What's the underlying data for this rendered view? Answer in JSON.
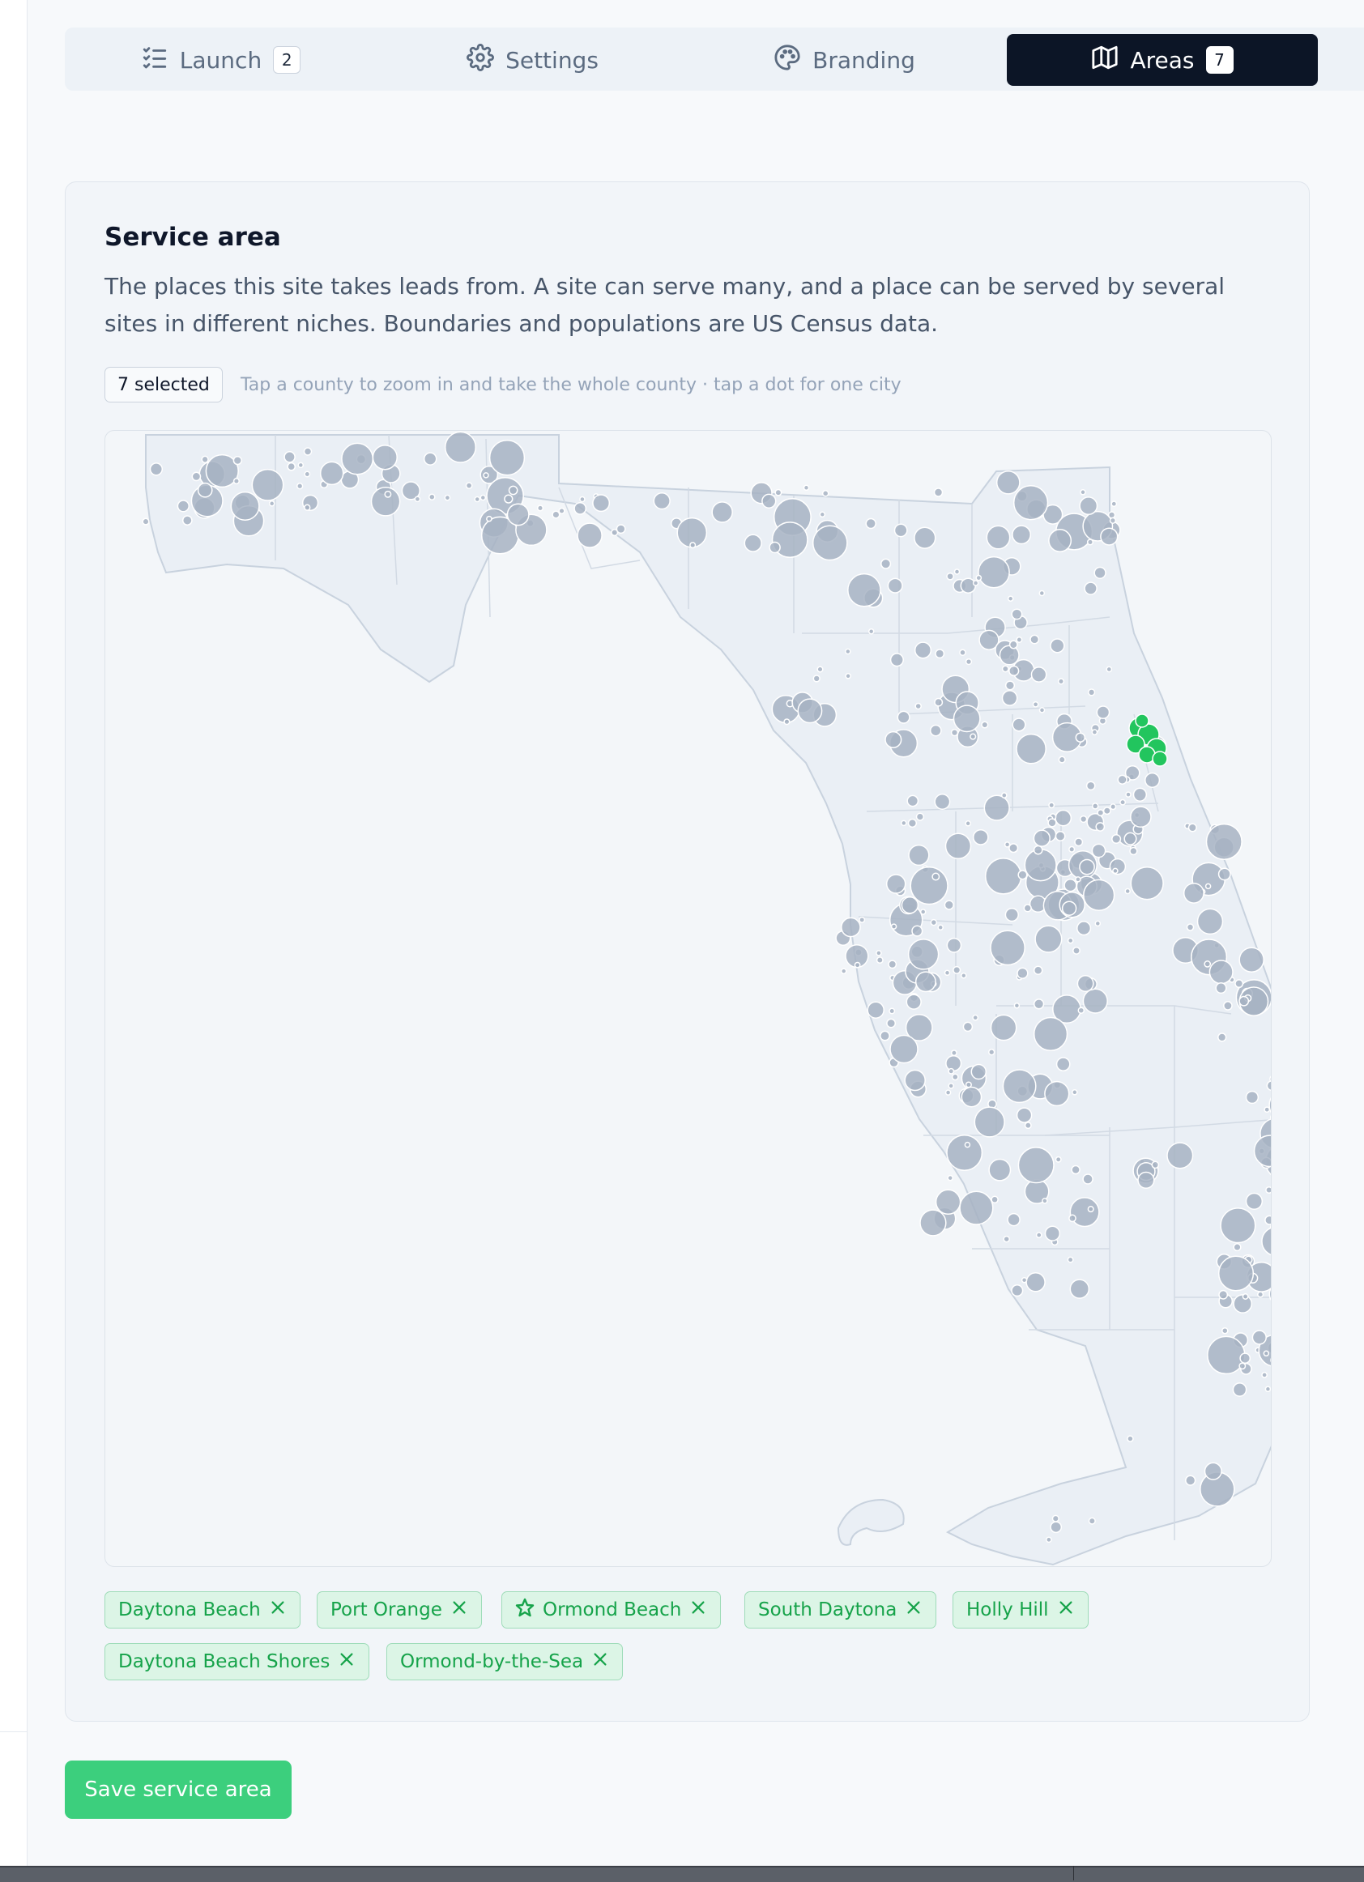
{
  "tabs": [
    {
      "label": "Launch",
      "count": "2",
      "icon": "checklist-icon",
      "active": false
    },
    {
      "label": "Settings",
      "icon": "gear-icon",
      "active": false
    },
    {
      "label": "Branding",
      "icon": "palette-icon",
      "active": false
    },
    {
      "label": "Areas",
      "count": "7",
      "icon": "map-icon",
      "active": true
    }
  ],
  "service_area": {
    "title": "Service area",
    "description": "The places this site takes leads from. A site can serve many, and a place can be served by several sites in different niches. Boundaries and populations are US Census data.",
    "selected_badge": "7 selected",
    "hint": "Tap a county to zoom in and take the whole county · tap a dot for one city"
  },
  "map": {
    "region": "Florida",
    "dot_color": "#a7b3c3",
    "selected_dot_color": "#22c55e",
    "selected_places": [
      "Daytona Beach",
      "Port Orange",
      "Ormond Beach",
      "South Daytona",
      "Holly Hill",
      "Daytona Beach Shores",
      "Ormond-by-the-Sea"
    ]
  },
  "chips": [
    {
      "label": "Daytona Beach",
      "starred": false
    },
    {
      "label": "Port Orange",
      "starred": false
    },
    {
      "label": "Ormond Beach",
      "starred": true
    },
    {
      "label": "South Daytona",
      "starred": false
    },
    {
      "label": "Holly Hill",
      "starred": false
    },
    {
      "label": "Daytona Beach Shores",
      "starred": false
    },
    {
      "label": "Ormond-by-the-Sea",
      "starred": false
    }
  ],
  "save_button": "Save service area",
  "colors": {
    "accent": "#3ccf7d",
    "tab_active_bg": "#0c1526",
    "chip_text": "#16a34a"
  }
}
